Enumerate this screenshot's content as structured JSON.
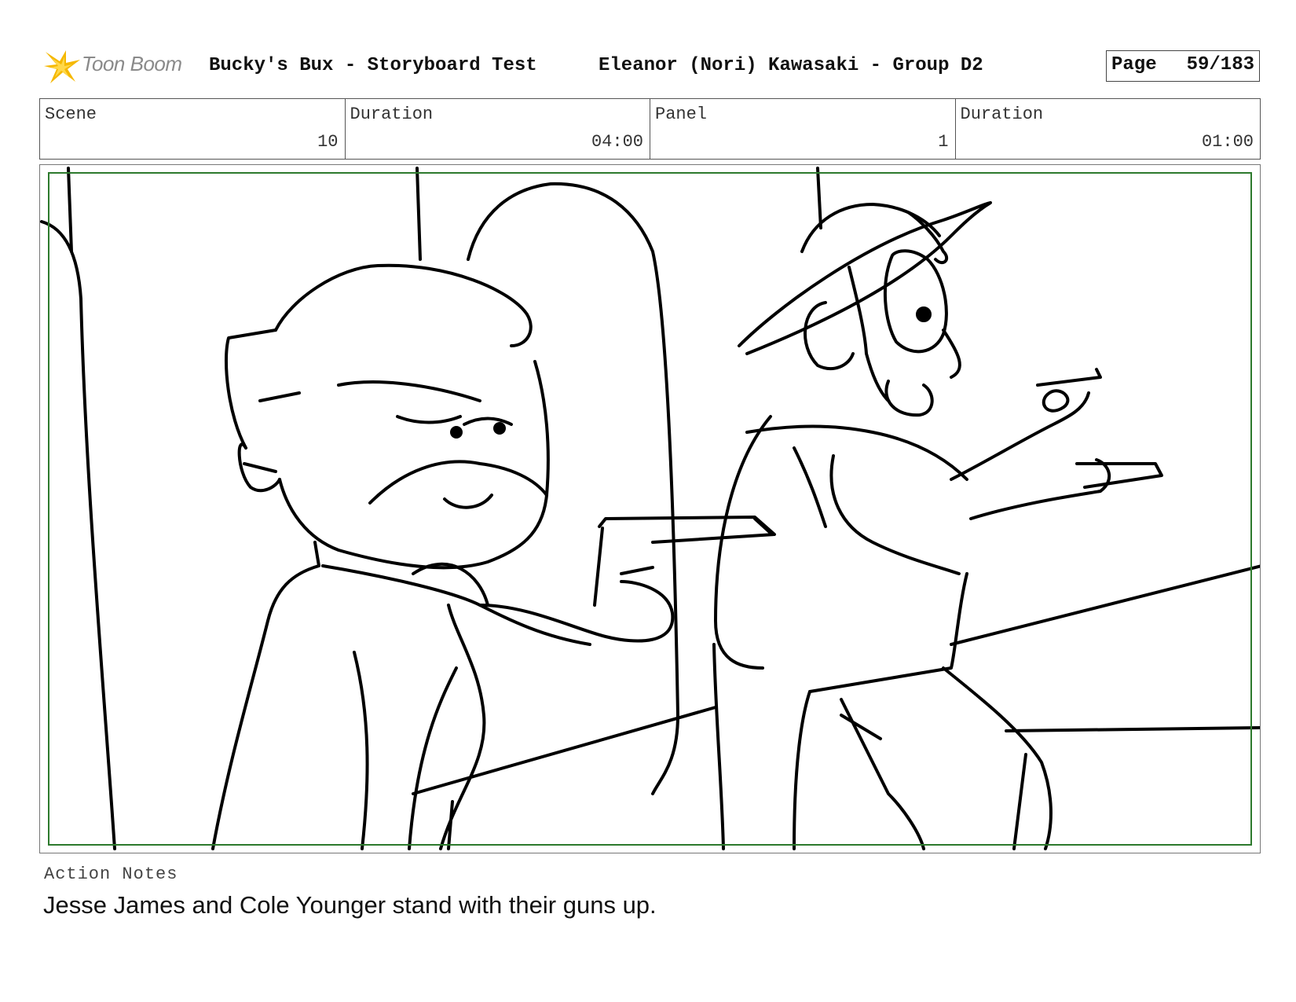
{
  "brand": {
    "name": "Toon Boom",
    "accent": "#f2b705"
  },
  "header": {
    "title": "Bucky's Bux - Storyboard Test",
    "author": "Eleanor (Nori) Kawasaki - Group D2",
    "page_label": "Page",
    "page_value": "59/183"
  },
  "info": {
    "scene_label": "Scene",
    "scene_value": "10",
    "scene_duration_label": "Duration",
    "scene_duration_value": "04:00",
    "panel_label": "Panel",
    "panel_value": "1",
    "panel_duration_label": "Duration",
    "panel_duration_value": "01:00"
  },
  "notes": {
    "label": "Action Notes",
    "text": "Jesse James and Cole Younger stand with their guns up."
  },
  "colors": {
    "safe_frame": "#2d7a2d"
  }
}
